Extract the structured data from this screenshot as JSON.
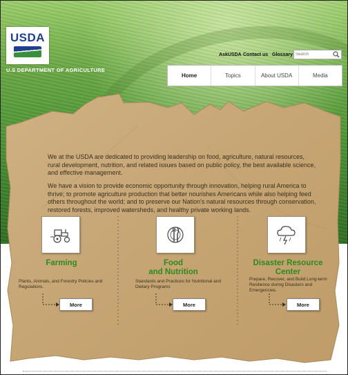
{
  "logo": {
    "text": "USDA"
  },
  "agency_name": "U.S DEPARTMENT OF AGRICULTURE",
  "utility_links": [
    "AskUSDA",
    "Contact us",
    "Glossary"
  ],
  "search": {
    "placeholder": "Search"
  },
  "nav": {
    "items": [
      "Home",
      "Topics",
      "About USDA",
      "Media"
    ],
    "active": "Home"
  },
  "intro": {
    "p1": "We at the USDA are dedicated to  providing leadership on food, agriculture, natural resources, rural development, nutrition, and related issues based on public policy, the best available science, and effective management.",
    "p2": "We have a vision to provide economic opportunity through innovation, helping rural America to thrive; to promote agriculture production that better nourishes Americans while also helping feed others throughout the world; and to preserve our Nation's natural resources through conservation, restored forests, improved watersheds, and healthy private working lands."
  },
  "features": [
    {
      "title": "Farming",
      "desc": "Plants, Animals, and Forestry Policies and Regulations.",
      "button": "More",
      "icon": "tractor-icon"
    },
    {
      "title_line1": "Food",
      "title_line2": "and Nutrition",
      "desc": "Standards and Practices for Nutritional and Dietary Programs",
      "button": "More",
      "icon": "plate-utensils-icon"
    },
    {
      "title_line1": "Disaster Resource",
      "title_line2": "Center",
      "desc": "Prepare, Recover, and Build Long-term Resilience during Disasters and Emergencies.",
      "button": "More",
      "icon": "storm-cloud-icon"
    }
  ],
  "colors": {
    "accent_green": "#2c8a1e",
    "usda_blue": "#1f3f8c",
    "paper": "#c8a878"
  }
}
